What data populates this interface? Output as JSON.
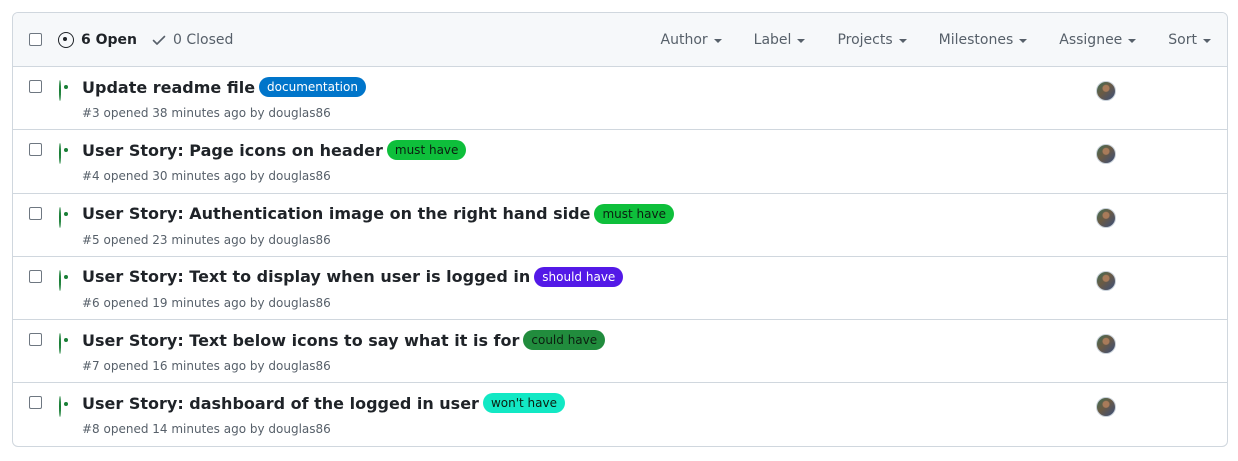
{
  "header": {
    "open_label": "6 Open",
    "closed_label": "0 Closed",
    "filters": [
      "Author",
      "Label",
      "Projects",
      "Milestones",
      "Assignee",
      "Sort"
    ]
  },
  "issues": [
    {
      "title": "Update readme file",
      "label": "documentation",
      "label_bg": "#0075ca",
      "label_fg": "#ffffff",
      "meta": "#3 opened 38 minutes ago by ",
      "author": "douglas86"
    },
    {
      "title": "User Story: Page icons on header",
      "label": "must have",
      "label_bg": "#0ebf3b",
      "label_fg": "#0b1f10",
      "meta": "#4 opened 30 minutes ago by ",
      "author": "douglas86"
    },
    {
      "title": "User Story: Authentication image on the right hand side",
      "label": "must have",
      "label_bg": "#0ebf3b",
      "label_fg": "#0b1f10",
      "meta": "#5 opened 23 minutes ago by ",
      "author": "douglas86"
    },
    {
      "title": "User Story: Text to display when user is logged in",
      "label": "should have",
      "label_bg": "#5319e7",
      "label_fg": "#ffffff",
      "meta": "#6 opened 19 minutes ago by ",
      "author": "douglas86"
    },
    {
      "title": "User Story: Text below icons to say what it is for",
      "label": "could have",
      "label_bg": "#218c3d",
      "label_fg": "#0b1f10",
      "meta": "#7 opened 16 minutes ago by ",
      "author": "douglas86"
    },
    {
      "title": "User Story: dashboard of the logged in user",
      "label": "won't have",
      "label_bg": "#12e8c4",
      "label_fg": "#0b1f10",
      "meta": "#8 opened 14 minutes ago by ",
      "author": "douglas86"
    }
  ]
}
